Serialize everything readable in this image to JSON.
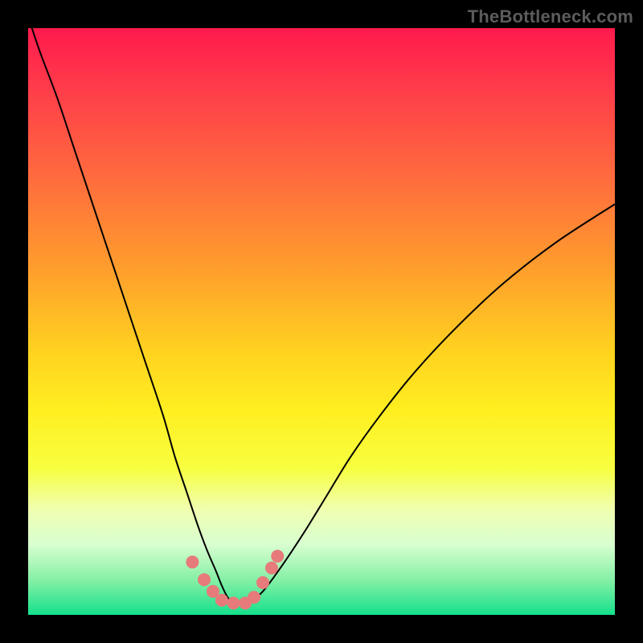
{
  "watermark": "TheBottleneck.com",
  "colors": {
    "frame": "#000000",
    "gradient_top": "#ff1a4d",
    "gradient_bottom": "#14e08c",
    "curve": "#000000",
    "marker": "#e77a7a"
  },
  "chart_data": {
    "type": "line",
    "title": "",
    "xlabel": "",
    "ylabel": "",
    "xlim": [
      0,
      100
    ],
    "ylim": [
      0,
      100
    ],
    "x": [
      0,
      2,
      5,
      8,
      11,
      14,
      17,
      20,
      23,
      25,
      27,
      29,
      30.5,
      32,
      33,
      34,
      35,
      36.5,
      38,
      40,
      43,
      47,
      51,
      55,
      60,
      66,
      73,
      81,
      90,
      100
    ],
    "values": [
      102,
      96,
      88,
      79,
      70,
      61,
      52,
      43,
      34,
      27,
      21,
      15,
      11,
      7.5,
      5,
      3,
      2,
      2,
      2.5,
      4,
      8,
      14,
      20.5,
      27,
      34,
      41.5,
      49,
      56.5,
      63.5,
      70
    ],
    "markers": [
      {
        "x": 28,
        "y": 9
      },
      {
        "x": 30,
        "y": 6
      },
      {
        "x": 31.5,
        "y": 4
      },
      {
        "x": 33,
        "y": 2.5
      },
      {
        "x": 35,
        "y": 2
      },
      {
        "x": 37,
        "y": 2
      },
      {
        "x": 38.5,
        "y": 3
      },
      {
        "x": 40,
        "y": 5.5
      },
      {
        "x": 41.5,
        "y": 8
      },
      {
        "x": 42.5,
        "y": 10
      }
    ]
  }
}
